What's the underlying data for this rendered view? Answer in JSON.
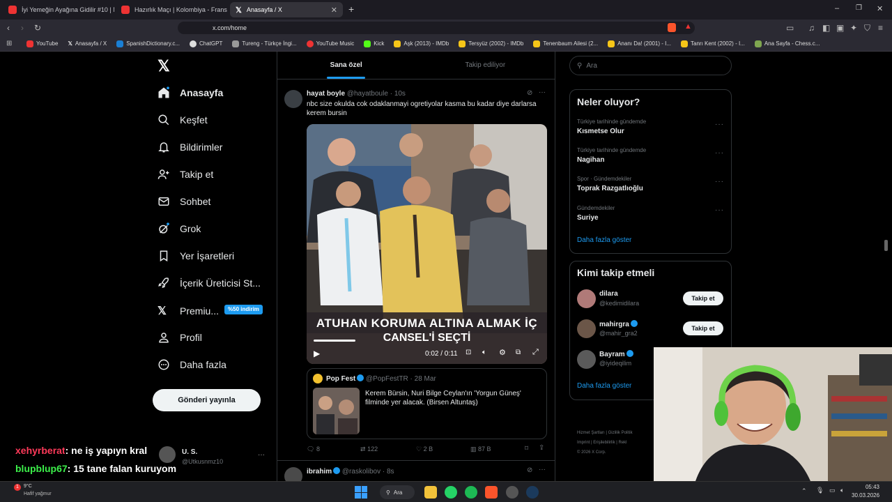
{
  "browser": {
    "tabs": [
      {
        "title": "İyi Yemeğin Ayağına Gidilir #10 | New",
        "icon": "youtube-icon"
      },
      {
        "title": "Hazırlık Maçı | Kolombiya - Fransa (Ö",
        "icon": "youtube-icon"
      },
      {
        "title": "Anasayfa / X",
        "icon": "x-logo-icon"
      }
    ],
    "url": "x.com/home",
    "bookmarks": [
      "YouTube",
      "Anasayfa / X",
      "SpanishDictionary.c...",
      "ChatGPT",
      "Tureng - Türkçe İngi...",
      "YouTube Music",
      "Kick",
      "Aşk (2013) - IMDb",
      "Tersyüz (2002) - IMDb",
      "Tenenbaum Ailesi (2...",
      "Ananı Da! (2001) - I...",
      "Tanrı Kent (2002) - I...",
      "Ana Sayfa - Chess.c..."
    ]
  },
  "sidebar": {
    "items": [
      "Anasayfa",
      "Keşfet",
      "Bildirimler",
      "Takip et",
      "Sohbet",
      "Grok",
      "Yer İşaretleri",
      "İçerik Üreticisi St...",
      "Premiu...",
      "Profil",
      "Daha fazla"
    ],
    "premium_badge": "%50 indirim",
    "post_button": "Gönderi yayınla",
    "account": {
      "name": "U. S.",
      "handle": "@Utkusnmz10"
    }
  },
  "feed": {
    "tabs": [
      "Sana özel",
      "Takip ediliyor"
    ],
    "tweet": {
      "name": "hayat boyle",
      "handle": "@hayatboule",
      "time": "10s",
      "text": "nbc size okulda cok odaklanmayi ogretiyolar kasma bu kadar diye darlarsa kerem bursin",
      "video_caption_line1": "ATUHAN KORUMA ALTINA ALMAK İÇ",
      "video_caption_line2": "CANSEL'İ SEÇTİ",
      "video_time": "0:02 / 0:11",
      "quote": {
        "name": "Pop Fest",
        "handle": "@PopFestTR",
        "date": "28 Mar",
        "text": "Kerem Bürsin, Nuri Bilge Ceylan'ın 'Yorgun Güneş' filminde yer alacak. (Birsen Altuntaş)"
      },
      "stats": {
        "replies": "8",
        "reposts": "122",
        "likes": "2 B",
        "views": "87 B"
      }
    },
    "next_tweet": {
      "name": "ibrahim",
      "handle": "@raskolibov",
      "time": "8s"
    }
  },
  "right": {
    "search_placeholder": "Ara",
    "trends_title": "Neler oluyor?",
    "trends": [
      {
        "context": "Türkiye tarihinde gündemde",
        "name": "Kısmetse Olur"
      },
      {
        "context": "Türkiye tarihinde gündemde",
        "name": "Nagihan"
      },
      {
        "context": "Spor · Gündemdekiler",
        "name": "Toprak Razgatlıoğlu"
      },
      {
        "context": "Gündemdekiler",
        "name": "Suriye"
      }
    ],
    "show_more": "Daha fazla göster",
    "who_title": "Kimi takip etmeli",
    "who": [
      {
        "name": "dilara",
        "handle": "@kedimidilara",
        "button": "Takip et"
      },
      {
        "name": "mahirgra",
        "handle": "@mahir_gra2",
        "button": "Takip et"
      },
      {
        "name": "Bayram",
        "handle": "@iyideqilim",
        "button": ""
      }
    ],
    "who_more": "Daha fazla göster",
    "footer": [
      "Hizmet Şartları",
      "|",
      "Gizlilik Politik",
      "Imprint",
      "|",
      "Erişilebilirlik",
      "|",
      "Rekl",
      "© 2026 X Corp."
    ]
  },
  "chat": [
    {
      "user": "xehyrberat",
      "msg": ": ne iş yapıyn kral",
      "color": "#ff3a5a"
    },
    {
      "user": "blupblup67",
      "msg": ": 15 tane falan kuruyom",
      "color": "#3cf04a"
    }
  ],
  "taskbar": {
    "weather_temp": "9°C",
    "weather_desc": "Hafif yağmur",
    "search": "Ara",
    "time": "05:43",
    "date": "30.03.2026"
  }
}
